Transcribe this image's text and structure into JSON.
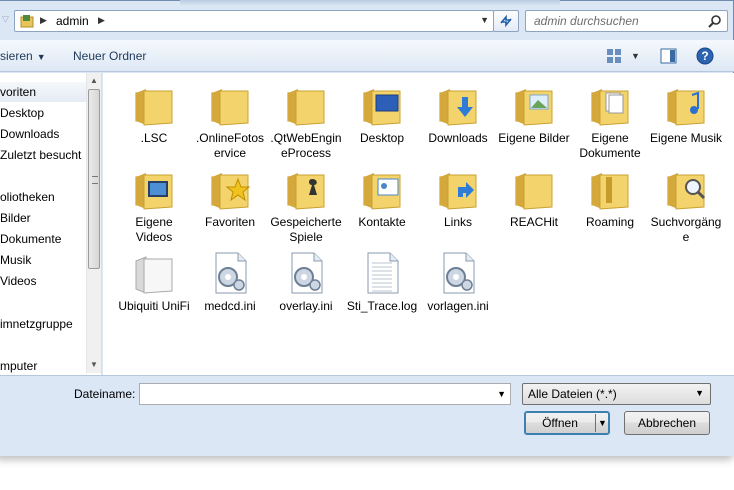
{
  "address": {
    "path_segment": "admin",
    "search_placeholder": "admin durchsuchen"
  },
  "toolbar": {
    "organize_label": "sieren",
    "new_folder_label": "Neuer Ordner"
  },
  "nav": {
    "items": [
      "voriten",
      "Desktop",
      "Downloads",
      "Zuletzt besucht",
      "",
      "oliotheken",
      "Bilder",
      "Dokumente",
      "Musik",
      "Videos",
      "",
      "imnetzgruppe",
      "",
      "mputer"
    ]
  },
  "files": [
    {
      "label": ".LSC",
      "icon": "folder"
    },
    {
      "label": ".OnlineFotoservice",
      "icon": "folder"
    },
    {
      "label": ".QtWebEngineProcess",
      "icon": "folder"
    },
    {
      "label": "Desktop",
      "icon": "folder-desktop"
    },
    {
      "label": "Downloads",
      "icon": "folder-downloads"
    },
    {
      "label": "Eigene Bilder",
      "icon": "folder-pictures"
    },
    {
      "label": "Eigene Dokumente",
      "icon": "folder-documents"
    },
    {
      "label": "Eigene Musik",
      "icon": "folder-music"
    },
    {
      "label": "Eigene Videos",
      "icon": "folder-videos"
    },
    {
      "label": "Favoriten",
      "icon": "folder-favorites"
    },
    {
      "label": "Gespeicherte Spiele",
      "icon": "folder-games"
    },
    {
      "label": "Kontakte",
      "icon": "folder-contacts"
    },
    {
      "label": "Links",
      "icon": "folder-links"
    },
    {
      "label": "REACHit",
      "icon": "folder"
    },
    {
      "label": "Roaming",
      "icon": "folder-roaming"
    },
    {
      "label": "Suchvorgänge",
      "icon": "folder-search"
    },
    {
      "label": "Ubiquiti UniFi",
      "icon": "folder-white"
    },
    {
      "label": "medcd.ini",
      "icon": "ini-file"
    },
    {
      "label": "overlay.ini",
      "icon": "ini-file"
    },
    {
      "label": "Sti_Trace.log",
      "icon": "text-file"
    },
    {
      "label": "vorlagen.ini",
      "icon": "ini-file"
    }
  ],
  "bottom": {
    "filename_label": "Dateiname:",
    "filename_value": "",
    "filetype_value": "Alle Dateien (*.*)",
    "open_label": "Öffnen",
    "cancel_label": "Abbrechen"
  },
  "colors": {
    "chrome": "#dbe7f5",
    "toolbar_text": "#1e395b",
    "folder_yellow": "#f3d36b"
  }
}
